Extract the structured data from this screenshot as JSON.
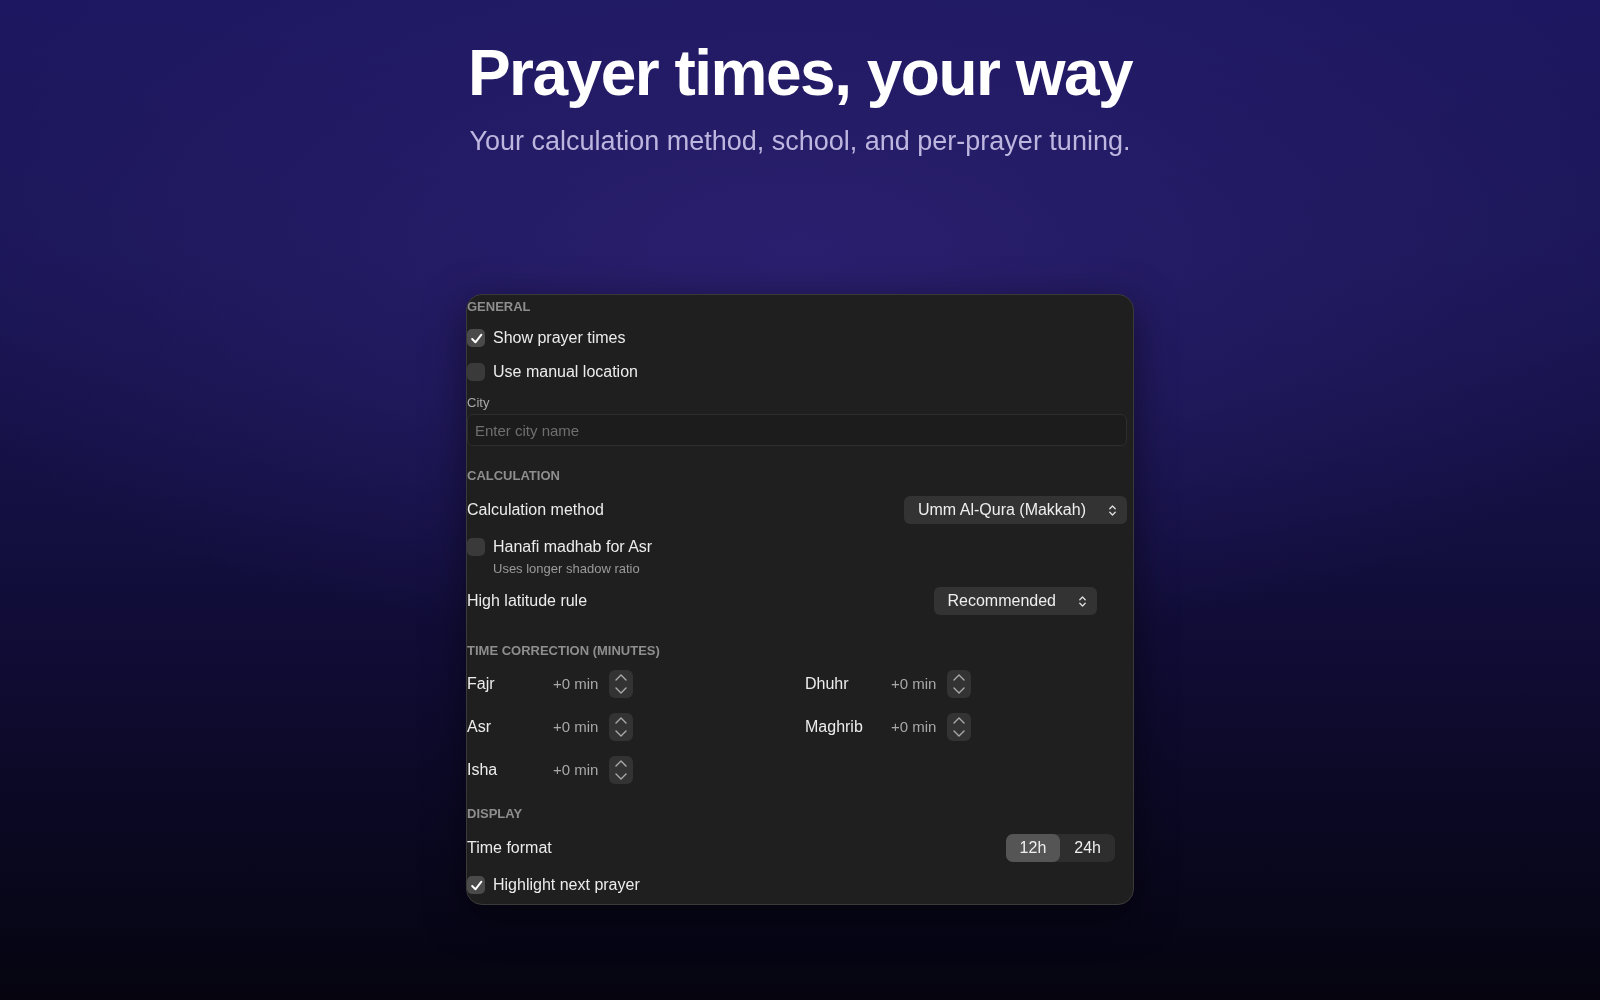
{
  "header": {
    "title": "Prayer times, your way",
    "subtitle": "Your calculation method, school, and per-prayer tuning."
  },
  "sections": [
    {
      "title": "GENERAL",
      "items": [
        {
          "kind": "checkbox",
          "label": "Show prayer times",
          "checked": true
        },
        {
          "kind": "checkbox",
          "label": "Use manual location",
          "checked": false
        },
        {
          "kind": "field",
          "label": "City",
          "placeholder": "Enter city name"
        }
      ]
    },
    {
      "title": "CALCULATION",
      "items": [
        {
          "kind": "select",
          "label": "Calculation method",
          "value": "Umm Al-Qura (Makkah)"
        },
        {
          "kind": "checkbox",
          "label": "Hanafi madhab for Asr",
          "checked": false,
          "hint": "Uses longer shadow ratio"
        },
        {
          "kind": "select",
          "label": "High latitude rule",
          "value": "Recommended"
        }
      ]
    },
    {
      "title": "TIME CORRECTION (MINUTES)",
      "items": [
        {
          "kind": "corrections",
          "prayers": [
            {
              "name": "Fajr",
              "value": "+0 min"
            },
            {
              "name": "Dhuhr",
              "value": "+0 min"
            },
            {
              "name": "Asr",
              "value": "+0 min"
            },
            {
              "name": "Maghrib",
              "value": "+0 min"
            },
            {
              "name": "Isha",
              "value": "+0 min"
            }
          ]
        }
      ]
    },
    {
      "title": "DISPLAY",
      "items": [
        {
          "kind": "segmented",
          "label": "Time format",
          "options": [
            {
              "label": "12h",
              "selected": true
            },
            {
              "label": "24h",
              "selected": false
            }
          ]
        },
        {
          "kind": "checkbox",
          "label": "Highlight next prayer",
          "checked": true
        }
      ]
    }
  ]
}
